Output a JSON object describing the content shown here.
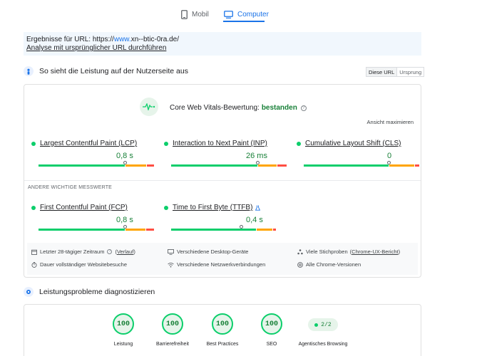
{
  "tabs": {
    "mobile": "Mobil",
    "desktop": "Computer"
  },
  "url_box": {
    "prefix": "Ergebnisse für URL: https://",
    "url_highlight": "www.",
    "url_rest": "xn--btic-0ra.de/",
    "link": "Analyse mit ursprünglicher URL durchführen"
  },
  "field": {
    "title": "So sieht die Leistung auf der Nutzerseite aus",
    "toggle": [
      "Diese URL",
      "Ursprung"
    ],
    "cwv_label": "Core Web Vitals-Bewertung:",
    "cwv_status": "bestanden",
    "expand": "Ansicht maximieren",
    "core_metrics": [
      {
        "name": "Largest Contentful Paint (LCP)",
        "value": "0,8 s"
      },
      {
        "name": "Interaction to Next Paint (INP)",
        "value": "26 ms"
      },
      {
        "name": "Cumulative Layout Shift (CLS)",
        "value": "0"
      }
    ],
    "other_label": "ANDERE WICHTIGE MESSWERTE",
    "other_metrics": [
      {
        "name": "First Contentful Paint (FCP)",
        "value": "0,8 s"
      },
      {
        "name": "Time to First Byte (TTFB)",
        "value": "0,4 s"
      }
    ],
    "info": {
      "period": "Letzter 28-tägiger Zeitraum",
      "history": "Verlauf",
      "devices": "Verschiedene Desktop-Geräte",
      "samples": "Viele Stichproben",
      "crux": "Chrome-UX-Bericht",
      "duration": "Dauer vollständiger Websitebesuche",
      "network": "Verschiedene Netzwerkverbindungen",
      "versions": "Alle Chrome-Versionen"
    }
  },
  "diagnose": {
    "title": "Leistungsprobleme diagnostizieren",
    "scores": [
      {
        "label": "Leistung",
        "score": "100"
      },
      {
        "label": "Barrierefreiheit",
        "score": "100"
      },
      {
        "label": "Best Practices",
        "score": "100"
      },
      {
        "label": "SEO",
        "score": "100"
      }
    ],
    "agentic": {
      "score": "2/2",
      "label": "Agentisches Browsing"
    }
  },
  "colors": {
    "accent": "#1a73e8",
    "good": "#0cce6b",
    "average": "#ffa400",
    "poor": "#ff4e42",
    "good_text": "#188038"
  },
  "bars": {
    "lcp": {
      "good": 0.75,
      "avg": 0.19,
      "poor": 0.06,
      "marker": 0.75
    },
    "inp": {
      "good": 0.75,
      "avg": 0.17,
      "poor": 0.08,
      "marker": 0.75
    },
    "cls": {
      "good": 0.74,
      "avg": 0.22,
      "poor": 0.04,
      "marker": 0.74
    },
    "fcp": {
      "good": 0.75,
      "avg": 0.18,
      "poor": 0.07,
      "marker": 0.75
    },
    "ttfb": {
      "good": 0.74,
      "avg": 0.14,
      "poor": 0.03,
      "marker": 0.61
    }
  }
}
